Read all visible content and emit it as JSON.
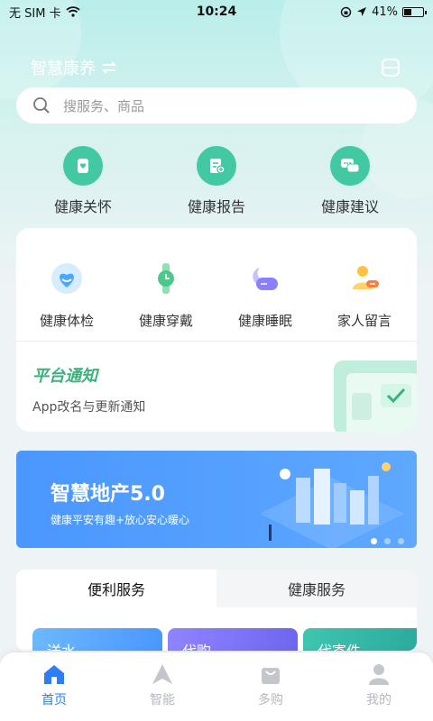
{
  "status_bar": {
    "carrier": "无 SIM 卡",
    "time": "10:24",
    "battery": "41%",
    "battery_level": 0.41
  },
  "header": {
    "title": "智慧康养"
  },
  "search": {
    "placeholder": "搜服务、商品"
  },
  "quick_actions": [
    {
      "label": "健康关怀",
      "icon": "heart-care-icon"
    },
    {
      "label": "健康报告",
      "icon": "report-icon"
    },
    {
      "label": "健康建议",
      "icon": "chat-icon"
    }
  ],
  "services": [
    {
      "label": "健康体检",
      "icon": "heart-check-icon"
    },
    {
      "label": "健康穿戴",
      "icon": "watch-icon"
    },
    {
      "label": "健康睡眠",
      "icon": "sleep-icon"
    },
    {
      "label": "家人留言",
      "icon": "message-user-icon"
    }
  ],
  "notice": {
    "title": "平台通知",
    "subtitle": "App改名与更新通知"
  },
  "banner": {
    "title": "智慧地产5.0",
    "subtitle": "健康平安有趣+放心安心暖心",
    "slides": 3,
    "active_slide": 0
  },
  "tabs": [
    {
      "label": "便利服务"
    },
    {
      "label": "健康服务"
    }
  ],
  "mini_cards": [
    {
      "label": "送水"
    },
    {
      "label": "代购"
    },
    {
      "label": "代寄件"
    }
  ],
  "bottom_nav": [
    {
      "label": "首页",
      "icon": "home-icon"
    },
    {
      "label": "智能",
      "icon": "navigate-icon"
    },
    {
      "label": "多购",
      "icon": "bag-icon"
    },
    {
      "label": "我的",
      "icon": "user-icon"
    }
  ],
  "colors": {
    "accent": "#2f7df6",
    "green": "#43c8a4",
    "banner": "#4a97ff"
  }
}
